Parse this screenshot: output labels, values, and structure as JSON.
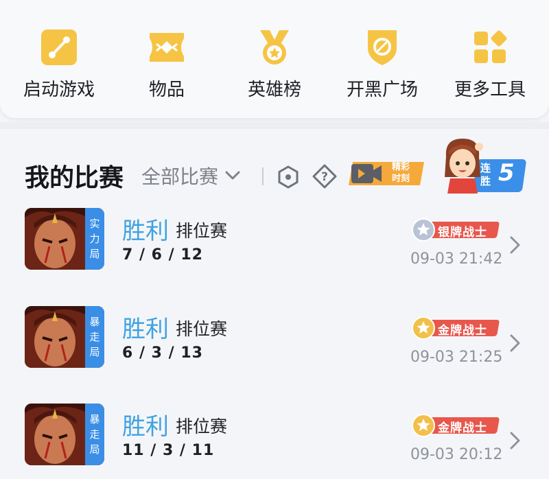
{
  "toolbar": {
    "items": [
      {
        "label": "启动游戏",
        "icon": "game-launch-icon"
      },
      {
        "label": "物品",
        "icon": "items-icon"
      },
      {
        "label": "英雄榜",
        "icon": "hero-medal-icon"
      },
      {
        "label": "开黑广场",
        "icon": "team-plaza-icon"
      },
      {
        "label": "更多工具",
        "icon": "more-tools-icon"
      }
    ]
  },
  "matches_section": {
    "title": "我的比赛",
    "filter": "全部比赛",
    "highlight_label_1": "精彩",
    "highlight_label_2": "时刻",
    "streak_label_1": "连",
    "streak_label_2": "胜",
    "streak_count": "5"
  },
  "matches": [
    {
      "tag": [
        "实",
        "力",
        "局"
      ],
      "result": "胜利",
      "mode": "排位赛",
      "kda": "7 / 6 / 12",
      "rank": "银牌战士",
      "rank_color": "#b9c3d6",
      "time": "09-03 21:42"
    },
    {
      "tag": [
        "暴",
        "走",
        "局"
      ],
      "result": "胜利",
      "mode": "排位赛",
      "kda": "6 / 3 / 13",
      "rank": "金牌战士",
      "rank_color": "#f2c04a",
      "time": "09-03 21:25"
    },
    {
      "tag": [
        "暴",
        "走",
        "局"
      ],
      "result": "胜利",
      "mode": "排位赛",
      "kda": "11 / 3 / 11",
      "rank": "金牌战士",
      "rank_color": "#f2c04a",
      "time": "09-03 20:12"
    }
  ],
  "colors": {
    "accent": "#3fa3e0",
    "icon_yellow": "#f6c445",
    "badge_red": "#e8574c",
    "badge_blue": "#3a8ee6"
  }
}
